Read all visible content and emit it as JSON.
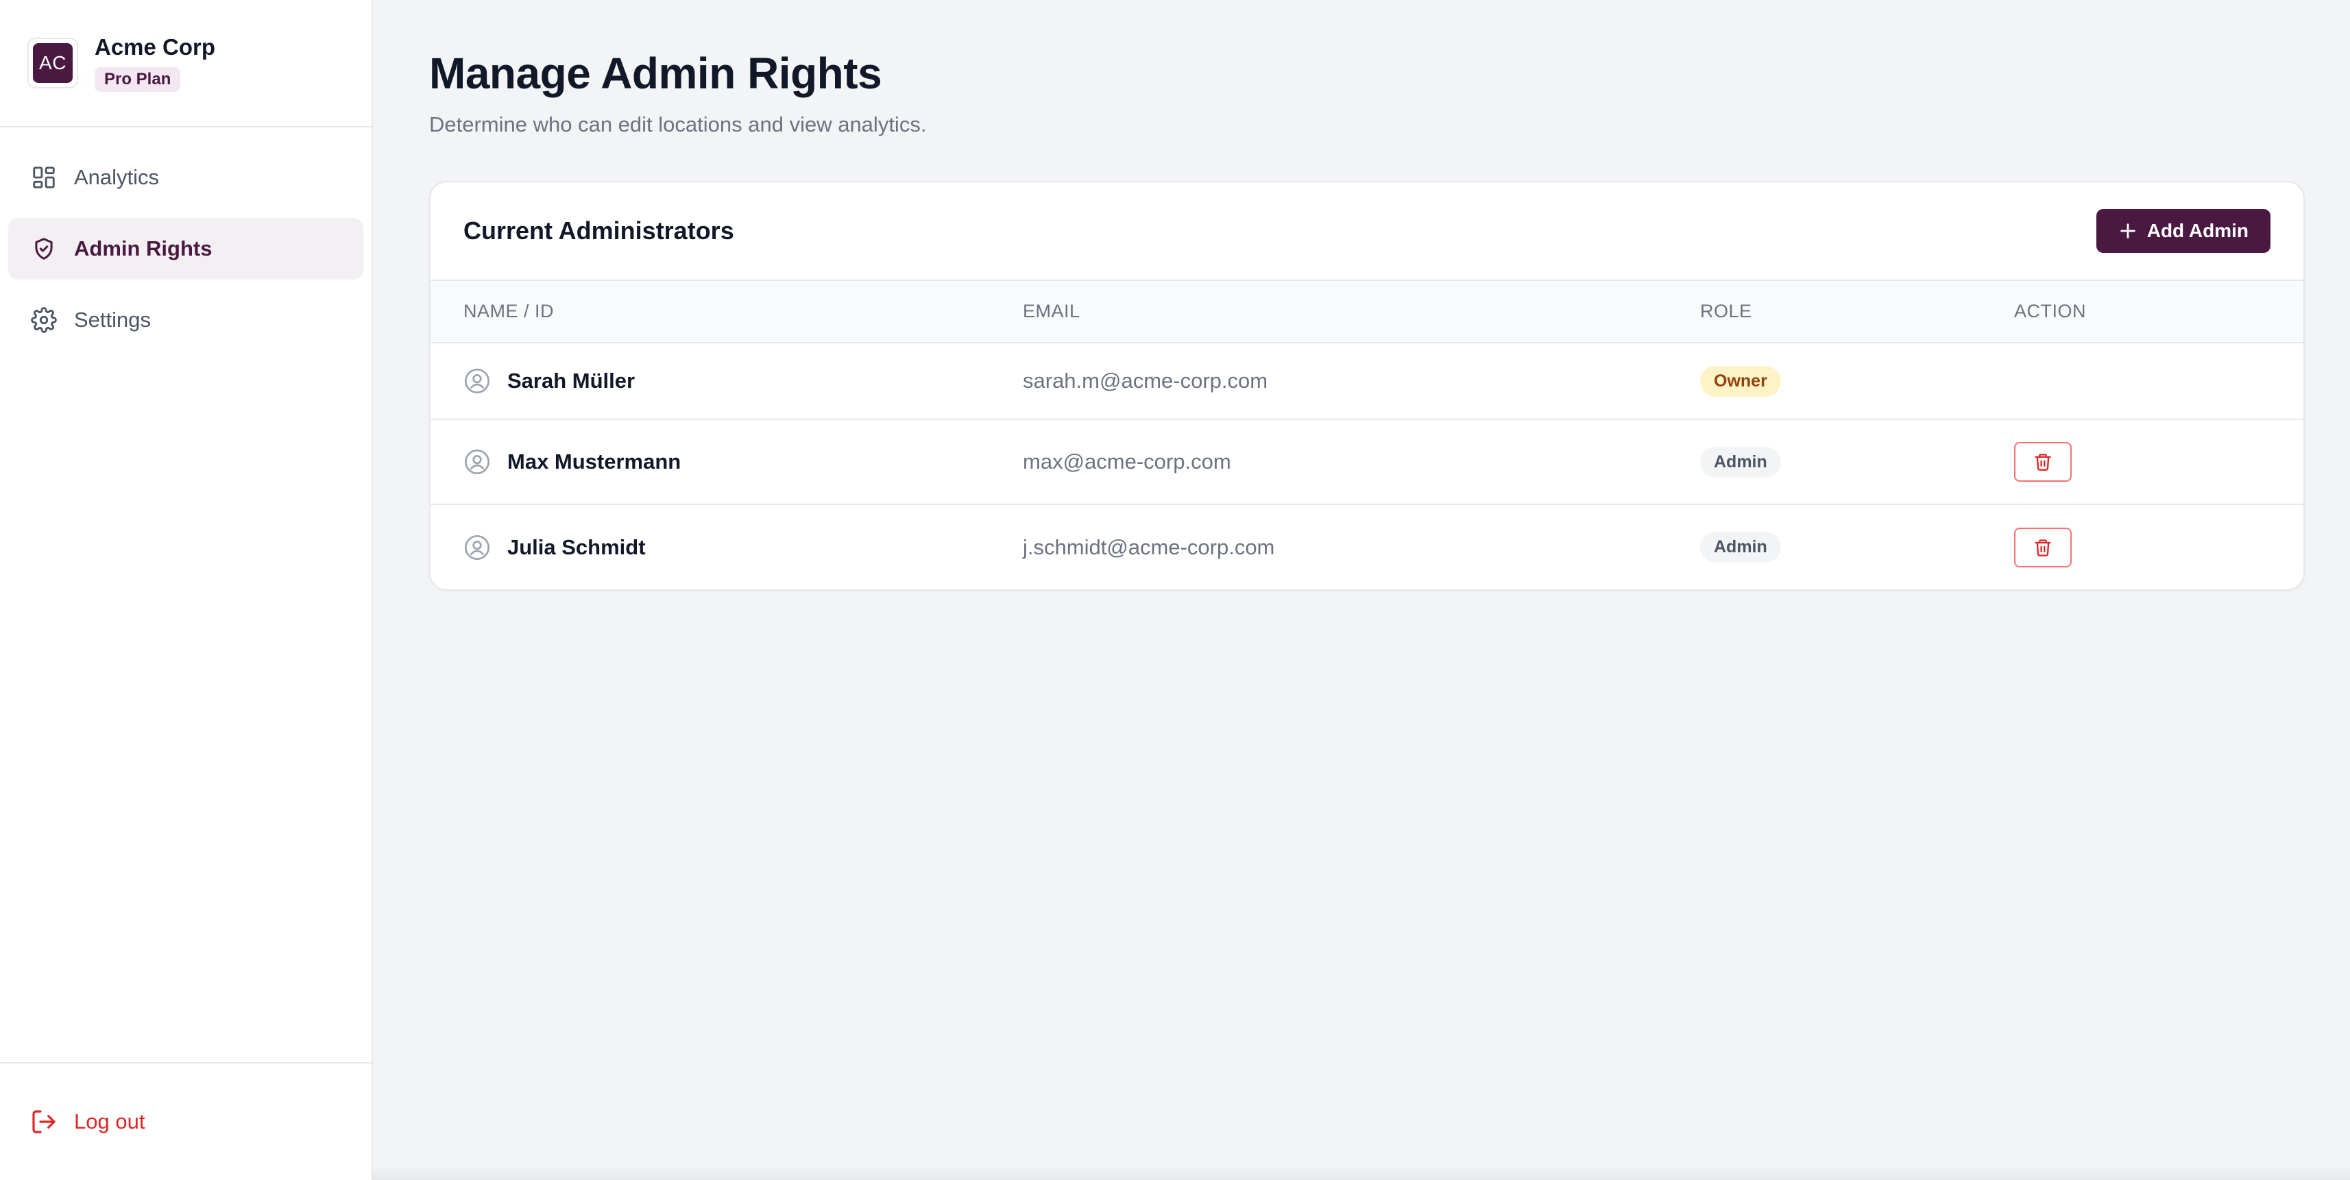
{
  "brand": {
    "logo_initials": "AC",
    "name": "Acme Corp",
    "plan": "Pro Plan"
  },
  "sidebar": {
    "items": [
      {
        "label": "Analytics",
        "icon": "dashboard-grid-icon",
        "active": false
      },
      {
        "label": "Admin Rights",
        "icon": "shield-check-icon",
        "active": true
      },
      {
        "label": "Settings",
        "icon": "gear-icon",
        "active": false
      }
    ],
    "logout_label": "Log out"
  },
  "page": {
    "title": "Manage Admin Rights",
    "subtitle": "Determine who can edit locations and view analytics."
  },
  "admins_card": {
    "title": "Current Administrators",
    "add_button_label": "Add Admin",
    "columns": [
      "NAME / ID",
      "EMAIL",
      "ROLE",
      "ACTION"
    ],
    "rows": [
      {
        "name": "Sarah Müller",
        "email": "sarah.m@acme-corp.com",
        "role": "Owner",
        "deletable": false
      },
      {
        "name": "Max Mustermann",
        "email": "max@acme-corp.com",
        "role": "Admin",
        "deletable": true
      },
      {
        "name": "Julia Schmidt",
        "email": "j.schmidt@acme-corp.com",
        "role": "Admin",
        "deletable": true
      }
    ]
  },
  "colors": {
    "brand": "#4a1942",
    "danger": "#dc2626",
    "owner_badge_bg": "#fef3c7",
    "owner_badge_text": "#92400e"
  }
}
